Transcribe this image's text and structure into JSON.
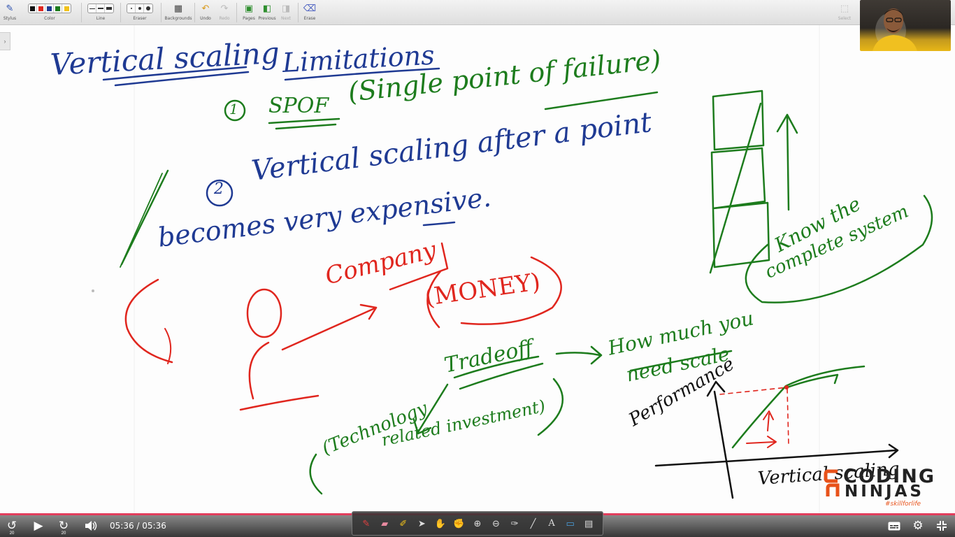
{
  "toolbar": {
    "labels": {
      "stylus": "Stylus",
      "color": "Color",
      "line": "Line",
      "eraser": "Eraser",
      "backgrounds": "Backgrounds",
      "undo": "Undo",
      "redo": "Redo",
      "pages": "Pages",
      "previous": "Previous",
      "next": "Next",
      "erase": "Erase",
      "select": "Select"
    },
    "color_swatches": [
      "#111111",
      "#e0261e",
      "#1f3a93",
      "#1d7c1d",
      "#f2c21a"
    ],
    "icons": {
      "stylus": "pen-icon",
      "backgrounds": "keyboard-icon",
      "undo": "undo-icon",
      "redo": "redo-icon",
      "pages": "add-page-icon",
      "previous": "previous-page-icon",
      "next": "next-page-icon",
      "erase": "erase-all-icon",
      "select": "select-icon"
    }
  },
  "board": {
    "ink_colors": {
      "blue": "#1f3a93",
      "green": "#1d7c1d",
      "red": "#e0261e",
      "black": "#111111"
    },
    "notes": {
      "title": "Vertical scaling",
      "limitations": "Limitations",
      "point1_num": "1",
      "point1": "SPOF",
      "point1_detail": "(Single point of failure)",
      "point2_num": "2",
      "point2_line1": "Vertical scaling after a point",
      "point2_line2": "becomes very expensive.",
      "company": "Company",
      "money": "(MONEY)",
      "tradeoff": "Tradeoff",
      "tech_line1": "(Technology",
      "tech_line2": "related investment)",
      "how_much": "How much you",
      "how_much2": "need scale",
      "performance": "Performance",
      "vertical_scaling_axis": "Vertical scaling",
      "know_line1": "Know the",
      "know_line2": "complete system"
    }
  },
  "webcam": {
    "description_icon": "presenter-webcam-icon"
  },
  "logo": {
    "line1": "CODING",
    "line2": "NINJAS",
    "tagline": "#skillforlife",
    "brand_color": "#e8521a"
  },
  "player": {
    "time": "05:36 / 05:36",
    "progress_fraction": 1.0,
    "rewind_seconds": "20",
    "forward_seconds": "20",
    "accent": "#e23d5c",
    "icons": {
      "rewind": "rewind-20-icon",
      "play": "play-icon",
      "forward": "forward-20-icon",
      "volume": "volume-icon",
      "captions": "captions-icon",
      "settings": "gear-icon",
      "fullscreen": "exit-fullscreen-icon"
    }
  },
  "annotation_bar": {
    "tools": [
      "pen-icon",
      "highlighter-eraser-icon",
      "marker-icon",
      "pointer-icon",
      "hand-icon",
      "grab-icon",
      "zoom-in-icon",
      "zoom-out-icon",
      "pipette-icon",
      "line-icon",
      "text-icon",
      "screen-icon",
      "ruler-icon"
    ]
  }
}
